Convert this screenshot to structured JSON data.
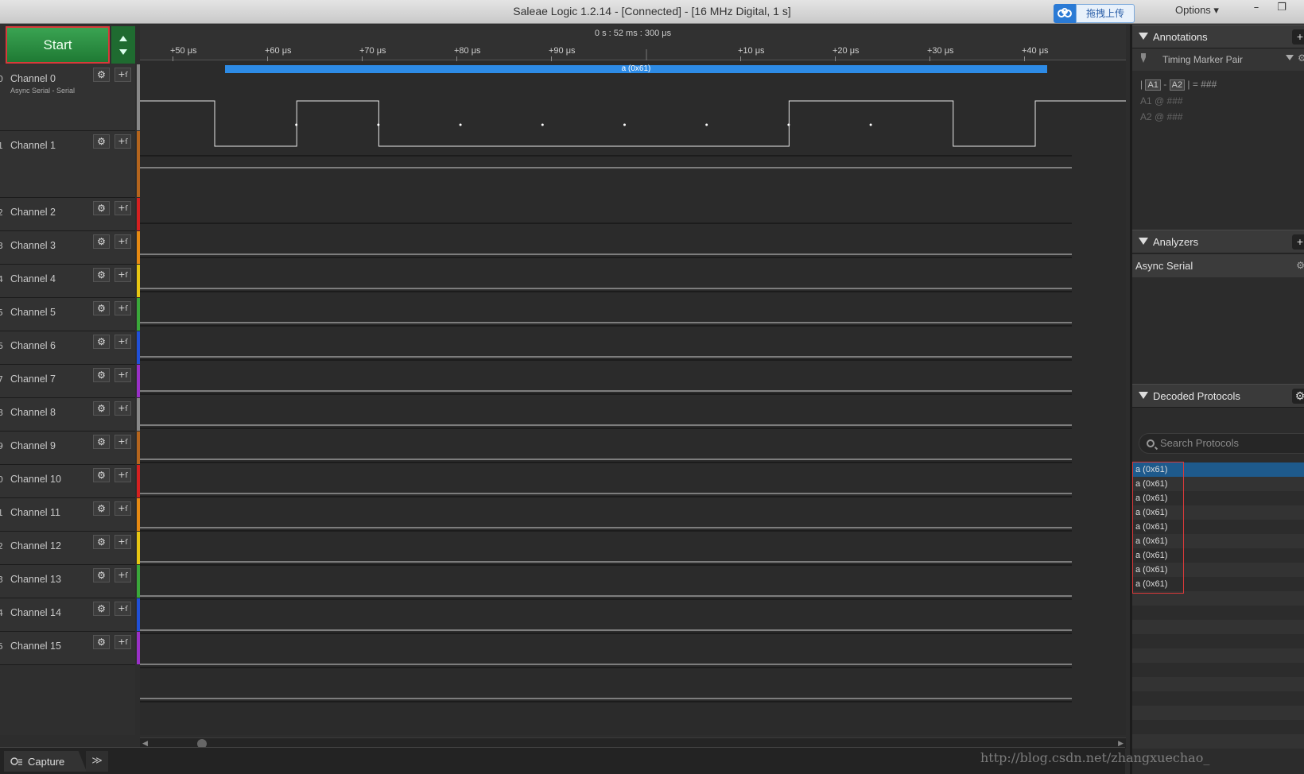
{
  "window": {
    "title": "Saleae Logic 1.2.14 - [Connected] - [16 MHz Digital, 1 s]",
    "upload_label": "拖拽上传",
    "options_label": "Options ▾",
    "minimize": "–",
    "restore": "❐"
  },
  "toolbar": {
    "start_label": "Start"
  },
  "ruler": {
    "center_time": "0 s : 52 ms : 300 μs",
    "ticks": [
      "+50 μs",
      "+60 μs",
      "+70 μs",
      "+80 μs",
      "+90 μs",
      "+10 μs",
      "+20 μs",
      "+30 μs",
      "+40 μs"
    ]
  },
  "channels": [
    {
      "index": "0",
      "name": "Channel 0",
      "sub": "Async Serial - Serial",
      "color": "#888888"
    },
    {
      "index": "1",
      "name": "Channel 1",
      "sub": "",
      "color": "#b5651d"
    },
    {
      "index": "2",
      "name": "Channel 2",
      "sub": "",
      "color": "#d62020"
    },
    {
      "index": "3",
      "name": "Channel 3",
      "sub": "",
      "color": "#e88a12"
    },
    {
      "index": "4",
      "name": "Channel 4",
      "sub": "",
      "color": "#e8c612"
    },
    {
      "index": "5",
      "name": "Channel 5",
      "sub": "",
      "color": "#3aa83a"
    },
    {
      "index": "6",
      "name": "Channel 6",
      "sub": "",
      "color": "#2050d8"
    },
    {
      "index": "7",
      "name": "Channel 7",
      "sub": "",
      "color": "#9a30c8"
    },
    {
      "index": "8",
      "name": "Channel 8",
      "sub": "",
      "color": "#888888"
    },
    {
      "index": "9",
      "name": "Channel 9",
      "sub": "",
      "color": "#b5651d"
    },
    {
      "index": "0",
      "name": "Channel 10",
      "sub": "",
      "color": "#d62020"
    },
    {
      "index": "1",
      "name": "Channel 11",
      "sub": "",
      "color": "#e88a12"
    },
    {
      "index": "2",
      "name": "Channel 12",
      "sub": "",
      "color": "#e8c612"
    },
    {
      "index": "3",
      "name": "Channel 13",
      "sub": "",
      "color": "#3aa83a"
    },
    {
      "index": "4",
      "name": "Channel 14",
      "sub": "",
      "color": "#2050d8"
    },
    {
      "index": "5",
      "name": "Channel 15",
      "sub": "",
      "color": "#9a30c8"
    }
  ],
  "waveform": {
    "analyzer_label": "a (0x61)",
    "bit_sequence": [
      1,
      0,
      1,
      0,
      0,
      0,
      0,
      0,
      1,
      1,
      0,
      1,
      1
    ]
  },
  "annotations": {
    "header": "Annotations",
    "timing_marker": "Timing Marker Pair",
    "formula_a1": "A1",
    "formula_a2": "A2",
    "formula_sep": "-",
    "formula_result": "| = ###",
    "a1_line": "A1  @  ###",
    "a2_line": "A2  @  ###"
  },
  "analyzers": {
    "header": "Analyzers",
    "items": [
      "Async Serial"
    ]
  },
  "decoded": {
    "header": "Decoded Protocols",
    "search_placeholder": "Search Protocols",
    "rows": [
      "a (0x61)",
      "a (0x61)",
      "a (0x61)",
      "a (0x61)",
      "a (0x61)",
      "a (0x61)",
      "a (0x61)",
      "a (0x61)",
      "a (0x61)"
    ]
  },
  "capture": {
    "tab_label": "Capture",
    "more_label": "≫"
  },
  "watermark": "http://blog.csdn.net/zhangxuechao_"
}
